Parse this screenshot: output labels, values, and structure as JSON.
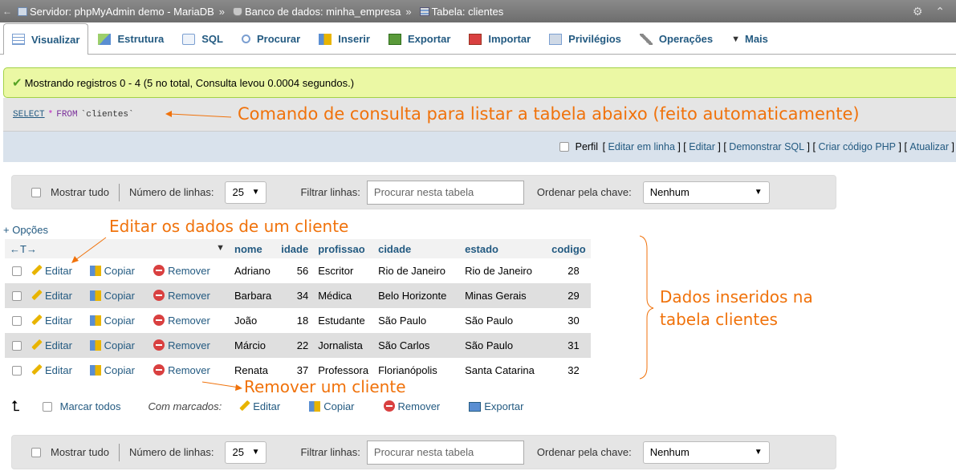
{
  "breadcrumb": {
    "back": "←",
    "server": "Servidor: phpMyAdmin demo - MariaDB",
    "sep": "»",
    "database": "Banco de dados: minha_empresa",
    "table": "Tabela: clientes",
    "right_icons": "⚙ ⌃"
  },
  "tabs": [
    {
      "label": "Visualizar",
      "icon": "browse-icon"
    },
    {
      "label": "Estrutura",
      "icon": "structure-icon"
    },
    {
      "label": "SQL",
      "icon": "sql-icon"
    },
    {
      "label": "Procurar",
      "icon": "search-icon"
    },
    {
      "label": "Inserir",
      "icon": "insert-icon"
    },
    {
      "label": "Exportar",
      "icon": "export-icon"
    },
    {
      "label": "Importar",
      "icon": "import-icon"
    },
    {
      "label": "Privilégios",
      "icon": "privileges-icon"
    },
    {
      "label": "Operações",
      "icon": "operations-icon"
    },
    {
      "label": "Mais",
      "icon": "chevron-down-icon"
    }
  ],
  "success": "Mostrando registros 0 - 4 (5 no total, Consulta levou 0.0004 segundos.)",
  "query": {
    "select": "SELECT",
    "star": "*",
    "from": "FROM",
    "table": "`clientes`"
  },
  "links": {
    "perfil": "Perfil",
    "editar_em_linha": "Editar em linha",
    "editar": "Editar",
    "demonstrar": "Demonstrar SQL",
    "criar": "Criar código PHP",
    "atualizar": "Atualizar"
  },
  "navbar": {
    "show_all": "Mostrar tudo",
    "rows_label": "Número de linhas:",
    "rows_value": "25",
    "filter_label": "Filtrar linhas:",
    "filter_placeholder": "Procurar nesta tabela",
    "sort_label": "Ordenar pela chave:",
    "sort_value": "Nenhum"
  },
  "options_link": "+ Opções",
  "col_arrows": "←T→",
  "columns": [
    "nome",
    "idade",
    "profissao",
    "cidade",
    "estado",
    "codigo"
  ],
  "actions": {
    "edit": "Editar",
    "copy": "Copiar",
    "remove": "Remover"
  },
  "rows": [
    {
      "nome": "Adriano",
      "idade": "56",
      "profissao": "Escritor",
      "cidade": "Rio de Janeiro",
      "estado": "Rio de Janeiro",
      "codigo": "28"
    },
    {
      "nome": "Barbara",
      "idade": "34",
      "profissao": "Médica",
      "cidade": "Belo Horizonte",
      "estado": "Minas Gerais",
      "codigo": "29"
    },
    {
      "nome": "João",
      "idade": "18",
      "profissao": "Estudante",
      "cidade": "São Paulo",
      "estado": "São Paulo",
      "codigo": "30"
    },
    {
      "nome": "Márcio",
      "idade": "22",
      "profissao": "Jornalista",
      "cidade": "São Carlos",
      "estado": "São Paulo",
      "codigo": "31"
    },
    {
      "nome": "Renata",
      "idade": "37",
      "profissao": "Professora",
      "cidade": "Florianópolis",
      "estado": "Santa Catarina",
      "codigo": "32"
    }
  ],
  "bulk": {
    "mark_all": "Marcar todos",
    "with_marked": "Com marcados:",
    "edit": "Editar",
    "copy": "Copiar",
    "remove": "Remover",
    "export": "Exportar"
  },
  "annotations": {
    "query": "Comando de consulta para listar a tabela abaixo (feito automaticamente)",
    "edit": "Editar os dados de um cliente",
    "data_line1": "Dados inseridos na",
    "data_line2": "tabela clientes",
    "remove": "Remover um cliente"
  },
  "colors": {
    "accent": "#235a81",
    "annotation": "#f0720b",
    "success_bg": "#ebf8a4"
  }
}
